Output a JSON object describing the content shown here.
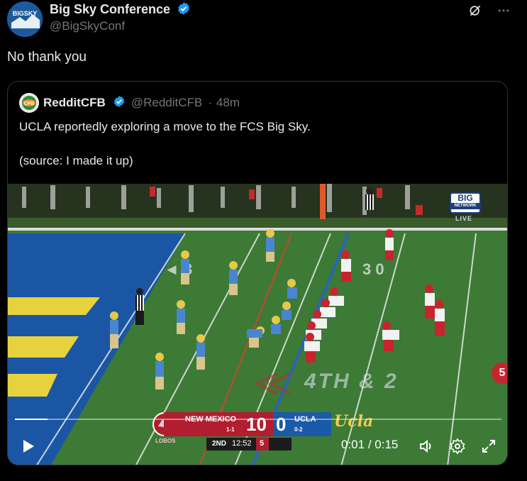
{
  "post": {
    "author_name": "Big Sky Conference",
    "author_handle": "@BigSkyConf",
    "avatar_text": "BIGSKY",
    "text": "No thank you"
  },
  "quote": {
    "author_name": "RedditCFB",
    "author_handle": "@RedditCFB",
    "separator": "·",
    "time_ago": "48m",
    "avatar_text": "CFB",
    "line1": "UCLA reportedly exploring a move to the FCS Big Sky.",
    "line2": "(source: I made it up)"
  },
  "video": {
    "current_time": "0:01",
    "time_separator": "/",
    "duration": "0:15",
    "progress_fraction": 0.067,
    "network_logo_text": "BIG",
    "network_logo_sub": "NETWORK",
    "network_live": "LIVE",
    "down_distance": "4TH & 2",
    "marker_number": "5",
    "scorebug": {
      "team1": "NEW MEXICO",
      "team1_record": "1-1",
      "team1_score": "10",
      "team2": "UCLA",
      "team2_record": "0-2",
      "team2_score": "0",
      "team2_wordmark": "Ucla",
      "quarter": "2ND",
      "clock": "12:52",
      "down": "5",
      "lobos": "LOBOS"
    }
  },
  "colors": {
    "background": "#000000",
    "verified": "#1d9bf0",
    "secondary_text": "#71767b",
    "border": "#2f3336"
  }
}
